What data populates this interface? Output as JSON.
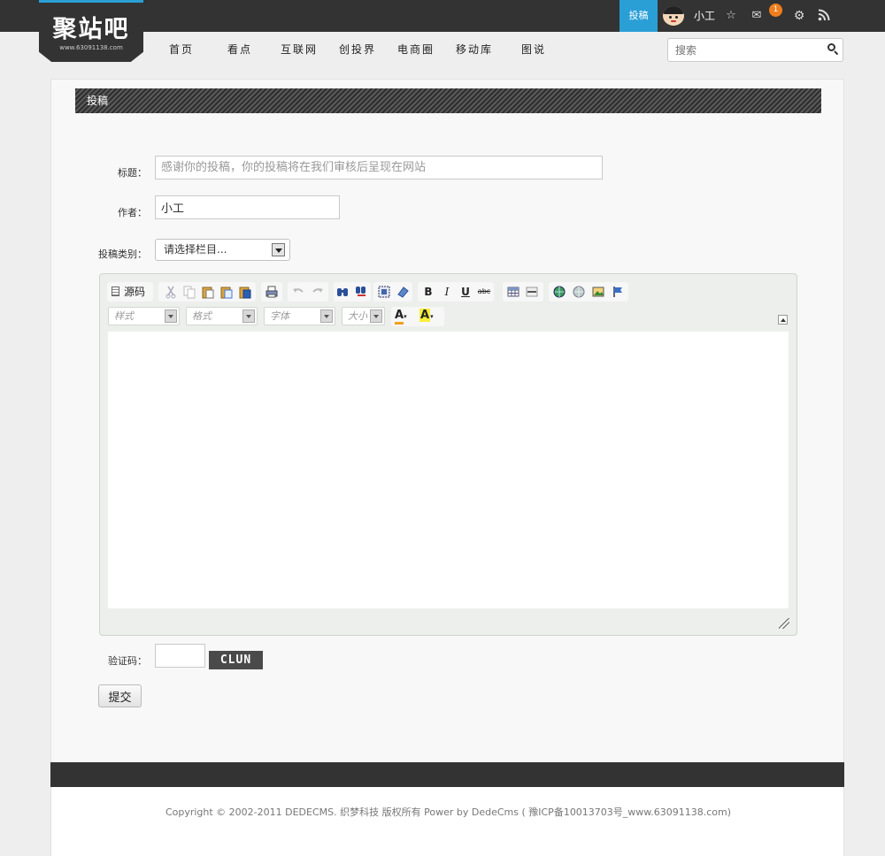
{
  "brand": {
    "name": "聚站吧",
    "domain": "www.63091138.com",
    "accent": "#2a9fd6"
  },
  "topbar": {
    "submit_label": "投稿",
    "username": "小工",
    "notification_count": "1",
    "icons": [
      "avatar",
      "star-icon",
      "mail-icon",
      "gear-icon",
      "rss-icon"
    ]
  },
  "nav": {
    "items": [
      "首页",
      "看点",
      "互联网",
      "创投界",
      "电商圈",
      "移动库",
      "图说"
    ],
    "search_placeholder": "搜索"
  },
  "panel": {
    "title": "投稿"
  },
  "form": {
    "title_label": "标题：",
    "title_placeholder": "感谢你的投稿，你的投稿将在我们审核后呈现在网站",
    "author_label": "作者：",
    "author_value": "小工",
    "category_label": "投稿类别：",
    "category_selected": "请选择栏目...",
    "captcha_label": "验证码：",
    "captcha_text": "CLUN",
    "submit_label": "提交"
  },
  "editor": {
    "source_label": "源码",
    "combos": [
      "样式",
      "格式",
      "字体",
      "大小"
    ],
    "toolbar_icons": [
      "cut-icon",
      "copy-icon",
      "paste-icon",
      "paste-text-icon",
      "paste-word-icon",
      "print-icon",
      "undo-icon",
      "redo-icon",
      "find-icon",
      "replace-icon",
      "select-all-icon",
      "remove-format-icon",
      "bold-icon",
      "italic-icon",
      "underline-icon",
      "strike-icon",
      "table-icon",
      "horizontal-rule-icon",
      "link-icon",
      "unlink-icon",
      "image-icon",
      "anchor-icon",
      "text-color-icon",
      "bg-color-icon"
    ]
  },
  "footer": {
    "copyright": "Copyright © 2002-2011 DEDECMS. 织梦科技 版权所有 Power by DedeCms ( 豫ICP备10013703号_www.63091138.com)"
  }
}
